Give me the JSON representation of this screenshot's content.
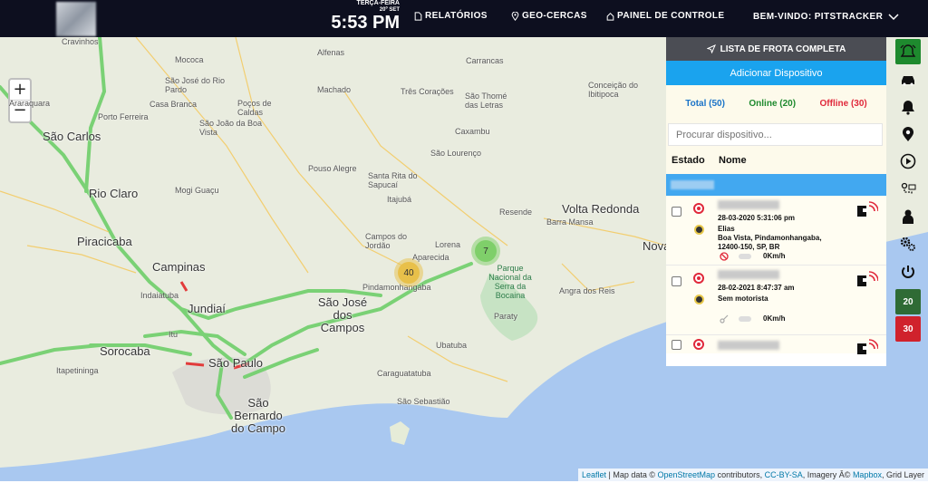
{
  "header": {
    "day": "TERÇA-FEIRA",
    "date": "20º SET",
    "time": "5:53 PM",
    "nav": [
      {
        "label": "RELATÓRIOS",
        "icon": "document-icon"
      },
      {
        "label": "GEO-CERCAS",
        "icon": "map-pin-icon"
      },
      {
        "label": "PAINEL DE CONTROLE",
        "icon": "home-icon"
      }
    ],
    "welcome": "BEM-VINDO: PITSTRACKER"
  },
  "map": {
    "zoom_in": "+",
    "zoom_out": "−",
    "cities": [
      "São Carlos",
      "Rio Claro",
      "Piracicaba",
      "Campinas",
      "Jundiaí",
      "Sorocaba",
      "São Paulo",
      "São Bernardo do Campo",
      "São José dos Campos",
      "Volta Redonda",
      "Nova"
    ],
    "towns": [
      "Cravinhos",
      "Araraquara",
      "Porto Ferreira",
      "Mococa",
      "São José do Rio Pardo",
      "Casa Branca",
      "São João da Boa Vista",
      "Poços de Caldas",
      "Mogi Guaçu",
      "Alfenas",
      "Machado",
      "Pouso Alegre",
      "Santa Rita do Sapucaí",
      "Itajubá",
      "Campos do Jordão",
      "Lorena",
      "Aparecida",
      "Pindamonhangaba",
      "Três Corações",
      "São Thomé das Letras",
      "Caxambu",
      "São Lourenço",
      "Carrancas",
      "Conceição do Ibitipoca",
      "Resende",
      "Barra Mansa",
      "Angra dos Reis",
      "Paraty",
      "Ubatuba",
      "Caraguatatuba",
      "São Sebastião",
      "Indaiatuba",
      "Itapetininga",
      "Itu"
    ],
    "park": "Parque Nacional da Serra da Bocaina",
    "clusters": [
      {
        "count": "40",
        "color": "#e8c04a"
      },
      {
        "count": "7",
        "color": "#7fcf6a"
      }
    ],
    "attribution": {
      "leaflet": "Leaflet",
      "text1": " | Map data © ",
      "osm": "OpenStreetMap",
      "text2": " contributors, ",
      "license": "CC-BY-SA",
      "text3": ", Imagery Â© ",
      "mapbox": "Mapbox",
      "text4": ", Grid Layer"
    }
  },
  "panel": {
    "title": "LISTA DE FROTA COMPLETA",
    "add_button": "Adicionar Dispositivo",
    "total": "Total (50)",
    "online": "Online (20)",
    "offline": "Offline (30)",
    "colors": {
      "total": "#1a73c8",
      "online": "#1e8a2e",
      "offline": "#e0283a"
    },
    "search_placeholder": "Procurar dispositivo...",
    "col_status": "Estado",
    "col_name": "Nome",
    "devices": [
      {
        "datetime": "28-03-2020 5:31:06 pm",
        "driver": "Elias",
        "address": "Boa Vista, Pindamonhangaba, 12400-150, SP, BR",
        "speed": "0Km/h"
      },
      {
        "datetime": "28-02-2021 8:47:37 am",
        "driver": "Sem motorista",
        "address": "",
        "speed": "0Km/h"
      }
    ]
  },
  "sidebar": {
    "buttons": [
      "alert-bell-icon",
      "car-icon",
      "bell-icon",
      "location-pin-icon",
      "play-icon",
      "route-icon",
      "driver-icon",
      "settings-gears-icon",
      "power-icon"
    ],
    "online_count": "20",
    "offline_count": "30"
  }
}
